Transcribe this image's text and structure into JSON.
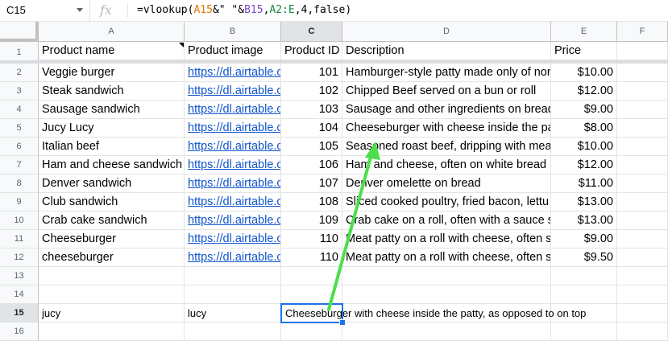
{
  "formula_bar": {
    "cell_ref": "C15",
    "fx_label": "fx",
    "formula_parts": [
      {
        "text": "=vlookup(",
        "cls": ""
      },
      {
        "text": "A15",
        "cls": "r1"
      },
      {
        "text": "&\" \"&",
        "cls": ""
      },
      {
        "text": "B15",
        "cls": "r2"
      },
      {
        "text": ",",
        "cls": ""
      },
      {
        "text": "A2:E",
        "cls": "r3"
      },
      {
        "text": ",4,false)",
        "cls": ""
      }
    ]
  },
  "columns": [
    "A",
    "B",
    "C",
    "D",
    "E",
    "F"
  ],
  "active_column": "C",
  "rows": [
    "1",
    "2",
    "3",
    "4",
    "5",
    "6",
    "7",
    "8",
    "9",
    "10",
    "11",
    "12",
    "13",
    "14",
    "15",
    "16"
  ],
  "active_row": "15",
  "header": {
    "product_name": "Product name",
    "product_image": "Product image",
    "product_id": "Product ID",
    "description": "Description",
    "price": "Price"
  },
  "products": [
    {
      "name": "Veggie burger",
      "image": "https://dl.airtable.c",
      "id": "101",
      "description": "Hamburger-style patty made only of non",
      "price": "$10.00"
    },
    {
      "name": "Steak sandwich",
      "image": "https://dl.airtable.c",
      "id": "102",
      "description": "Chipped Beef served on a bun or roll",
      "price": "$12.00"
    },
    {
      "name": "Sausage sandwich",
      "image": "https://dl.airtable.c",
      "id": "103",
      "description": "Sausage and other ingredients on bread",
      "price": "$9.00"
    },
    {
      "name": "Jucy Lucy",
      "image": "https://dl.airtable.c",
      "id": "104",
      "description": "Cheeseburger with cheese inside the pa",
      "price": "$8.00"
    },
    {
      "name": "Italian beef",
      "image": "https://dl.airtable.c",
      "id": "105",
      "description": "Seasoned roast beef, dripping with mea",
      "price": "$10.00"
    },
    {
      "name": "Ham and cheese sandwich",
      "image": "https://dl.airtable.c",
      "id": "106",
      "description": "Ham and cheese, often on white bread",
      "price": "$12.00"
    },
    {
      "name": "Denver sandwich",
      "image": "https://dl.airtable.c",
      "id": "107",
      "description": "Denver omelette on bread",
      "price": "$11.00"
    },
    {
      "name": "Club sandwich",
      "image": "https://dl.airtable.c",
      "id": "108",
      "description": "Sliced cooked poultry, fried bacon, lettu",
      "price": "$13.00"
    },
    {
      "name": "Crab cake sandwich",
      "image": "https://dl.airtable.c",
      "id": "109",
      "description": "Crab cake on a roll, often with a sauce s",
      "price": "$13.00"
    },
    {
      "name": "Cheeseburger",
      "image": "https://dl.airtable.c",
      "id": "110",
      "description": "Meat patty on a roll with cheese, often s",
      "price": "$9.00"
    },
    {
      "name": "cheeseburger",
      "image": "https://dl.airtable.c",
      "id": "110",
      "description": "Meat patty on a roll with cheese, often s",
      "price": "$9.50"
    }
  ],
  "row15": {
    "a": "jucy",
    "b": "lucy",
    "c": "Cheeseburger with cheese inside the patty, as opposed to on top"
  },
  "colors": {
    "selection": "#1a73e8",
    "arrow": "#4cde4c",
    "link": "#1155cc"
  }
}
